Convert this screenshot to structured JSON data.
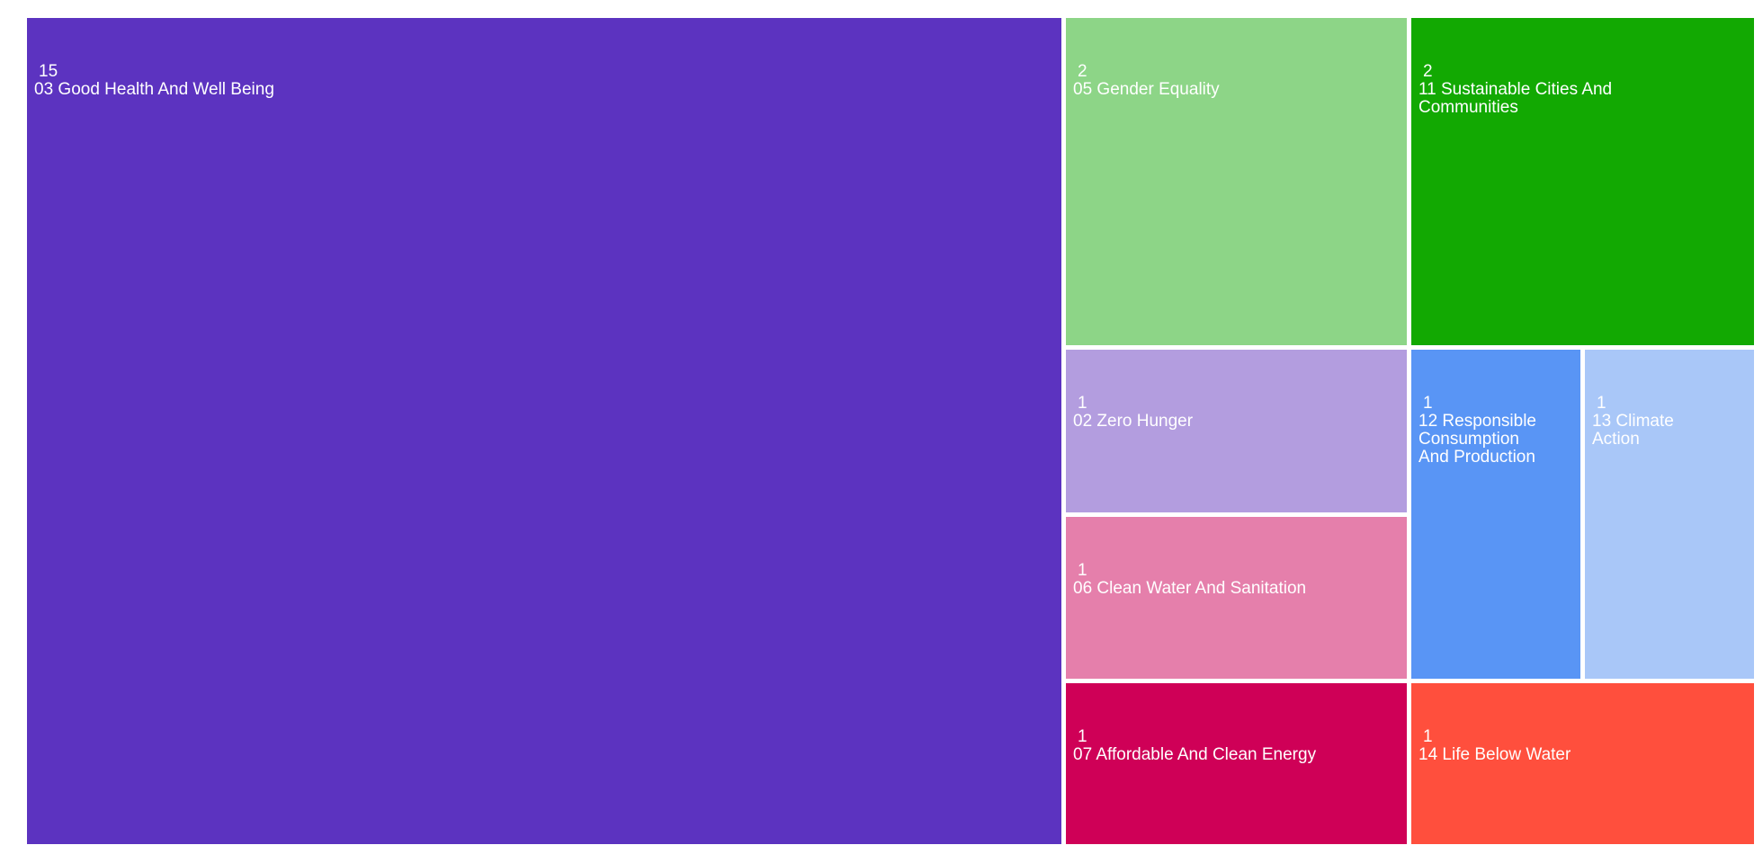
{
  "chart_data": {
    "type": "treemap",
    "items": [
      {
        "name": "03 Good Health And Well Being",
        "label": "03 Good Health And Well Being",
        "value": 15,
        "color": "#5c33c0"
      },
      {
        "name": "05 Gender Equality",
        "label": "05 Gender Equality",
        "value": 2,
        "color": "#8dd587"
      },
      {
        "name": "11 Sustainable Cities And Communities",
        "label": "    11 Sustainable Cities And\nCommunities",
        "value": 2,
        "color": "#12a902"
      },
      {
        "name": "02 Zero Hunger",
        "label": "02 Zero Hunger",
        "value": 1,
        "color": "#b39ddf"
      },
      {
        "name": "06 Clean Water And Sanitation",
        "label": "06 Clean Water And Sanitation",
        "value": 1,
        "color": "#e57fab"
      },
      {
        "name": "07 Affordable And Clean Energy",
        "label": "07 Affordable And Clean Energy",
        "value": 1,
        "color": "#cf0057"
      },
      {
        "name": "12 Responsible Consumption And Production",
        "label": "        12 Responsible\n    Consumption\nAnd Production",
        "value": 1,
        "color": "#5995f5"
      },
      {
        "name": "13 Climate Action",
        "label": "    13 Climate\nAction",
        "value": 1,
        "color": "#a9c7f8"
      },
      {
        "name": "14 Life Below Water",
        "label": "14 Life Below Water",
        "value": 1,
        "color": "#ff4f3d"
      }
    ]
  }
}
